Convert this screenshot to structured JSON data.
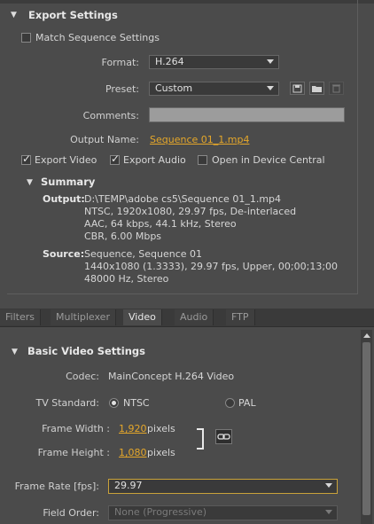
{
  "export_settings": {
    "title": "Export Settings",
    "match_sequence_label": "Match Sequence Settings",
    "format_label": "Format:",
    "format_value": "H.264",
    "preset_label": "Preset:",
    "preset_value": "Custom",
    "comments_label": "Comments:",
    "comments_value": "",
    "output_name_label": "Output Name:",
    "output_name_value": "Sequence 01_1.mp4",
    "export_video_label": "Export Video",
    "export_video_checked": true,
    "export_audio_label": "Export Audio",
    "export_audio_checked": true,
    "open_device_central_label": "Open in Device Central",
    "open_device_central_checked": false
  },
  "summary": {
    "title": "Summary",
    "output_label": "Output:",
    "output_lines": [
      "D:\\TEMP\\adobe cs5\\Sequence 01_1.mp4",
      "NTSC, 1920x1080, 29.97 fps, De-interlaced",
      "AAC, 64 kbps, 44.1 kHz, Stereo",
      "CBR, 6.00 Mbps"
    ],
    "source_label": "Source:",
    "source_lines": [
      "Sequence, Sequence 01",
      "1440x1080 (1.3333), 29.97 fps, Upper, 00;00;13;00",
      "48000 Hz, Stereo"
    ]
  },
  "tabs": [
    {
      "label": "Filters",
      "active": false
    },
    {
      "label": "Multiplexer",
      "active": false
    },
    {
      "label": "Video",
      "active": true
    },
    {
      "label": "Audio",
      "active": false
    },
    {
      "label": "FTP",
      "active": false
    }
  ],
  "video": {
    "title": "Basic Video Settings",
    "codec_label": "Codec:",
    "codec_value": "MainConcept H.264 Video",
    "tv_standard_label": "TV Standard:",
    "tv_ntsc": "NTSC",
    "tv_pal": "PAL",
    "tv_selected": "NTSC",
    "frame_width_label": "Frame Width :",
    "frame_width_value": "1,920",
    "frame_height_label": "Frame Height :",
    "frame_height_value": "1,080",
    "pixels_unit": "pixels",
    "frame_rate_label": "Frame Rate [fps]:",
    "frame_rate_value": "29.97",
    "field_order_label": "Field Order:",
    "field_order_value": "None (Progressive)"
  },
  "colors": {
    "background": "#4b4b4b",
    "accent_link": "#e5a72a",
    "panel_dark": "#3a3a3a"
  }
}
